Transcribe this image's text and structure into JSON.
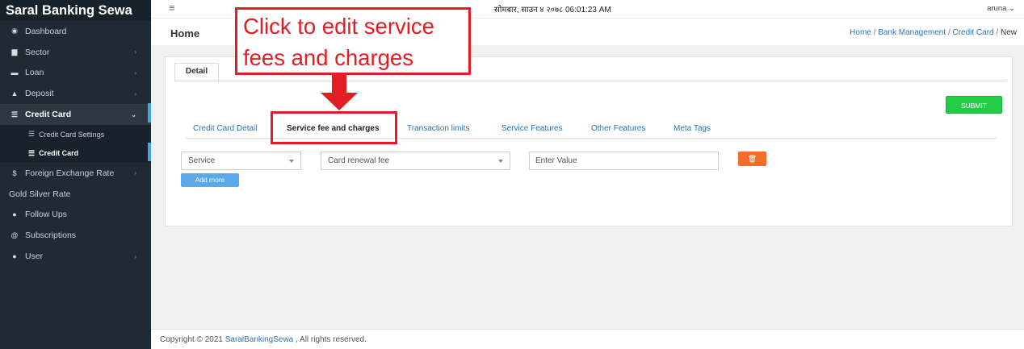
{
  "app": {
    "title": "Saral Banking Sewa"
  },
  "sidebar": {
    "items": [
      {
        "label": "Dashboard",
        "icon": "speedometer-icon",
        "glyph": "◉",
        "has_children": false
      },
      {
        "label": "Sector",
        "icon": "briefcase-icon",
        "glyph": "▆",
        "has_children": true
      },
      {
        "label": "Loan",
        "icon": "money-icon",
        "glyph": "▬",
        "has_children": true
      },
      {
        "label": "Deposit",
        "icon": "piggy-bank-icon",
        "glyph": "▲",
        "has_children": true
      },
      {
        "label": "Credit Card",
        "icon": "credit-card-icon",
        "glyph": "☰",
        "has_children": true,
        "expanded": true
      },
      {
        "label": "Foreign Exchange Rate",
        "icon": "dollar-icon",
        "glyph": "$",
        "has_children": true
      },
      {
        "label": "Gold Silver Rate",
        "has_children": false
      },
      {
        "label": "Follow Ups",
        "icon": "user-plus-icon",
        "glyph": "●",
        "has_children": false
      },
      {
        "label": "Subscriptions",
        "icon": "at-icon",
        "glyph": "@",
        "has_children": false
      },
      {
        "label": "User",
        "icon": "users-icon",
        "glyph": "●",
        "has_children": true
      }
    ],
    "credit_card_children": [
      {
        "label": "Credit Card Settings",
        "icon": "list-icon",
        "glyph": "☰"
      },
      {
        "label": "Credit Card",
        "icon": "list-icon",
        "glyph": "☰",
        "active": true
      }
    ],
    "chevron_right": "›",
    "chevron_down": "⌄"
  },
  "topbar": {
    "menu_glyph": "≡",
    "datetime": "सोमबार, साउन ४ २०७८  06:01:23 AM",
    "user": "aruna ⌄"
  },
  "header": {
    "page_title": "Home",
    "breadcrumb": [
      "Home",
      "Bank Management",
      "Credit Card",
      "New"
    ],
    "separator": "/"
  },
  "card": {
    "outer_tab": "Detail",
    "submit_label": "SUBMIT",
    "tabs": [
      {
        "label": "Credit Card Detail",
        "active": false
      },
      {
        "label": "Service fee and charges",
        "active": true
      },
      {
        "label": "Transaction limits",
        "active": false
      },
      {
        "label": "Service Features",
        "active": false
      },
      {
        "label": "Other Features",
        "active": false
      },
      {
        "label": "Meta Tags",
        "active": false
      }
    ],
    "form": {
      "service_select": "Service",
      "fee_select": "Card renewal fee",
      "value_placeholder": "Enter Value",
      "delete_glyph": "🗑",
      "add_more_label": "Add more"
    }
  },
  "footer": {
    "prefix": "Copyright © 2021 ",
    "link": "SaralBankingSewa",
    "suffix": " , All rights reserved."
  },
  "annotation": {
    "line1": "Click to edit service",
    "line2": "fees and charges",
    "color": "#e21d24"
  },
  "colors": {
    "sidebar_bg": "#1f2a33",
    "link": "#2a72b5",
    "submit": "#22cc44",
    "delete": "#f46d2a",
    "add_more": "#5aa9ea",
    "accent": "#4aa3df"
  }
}
